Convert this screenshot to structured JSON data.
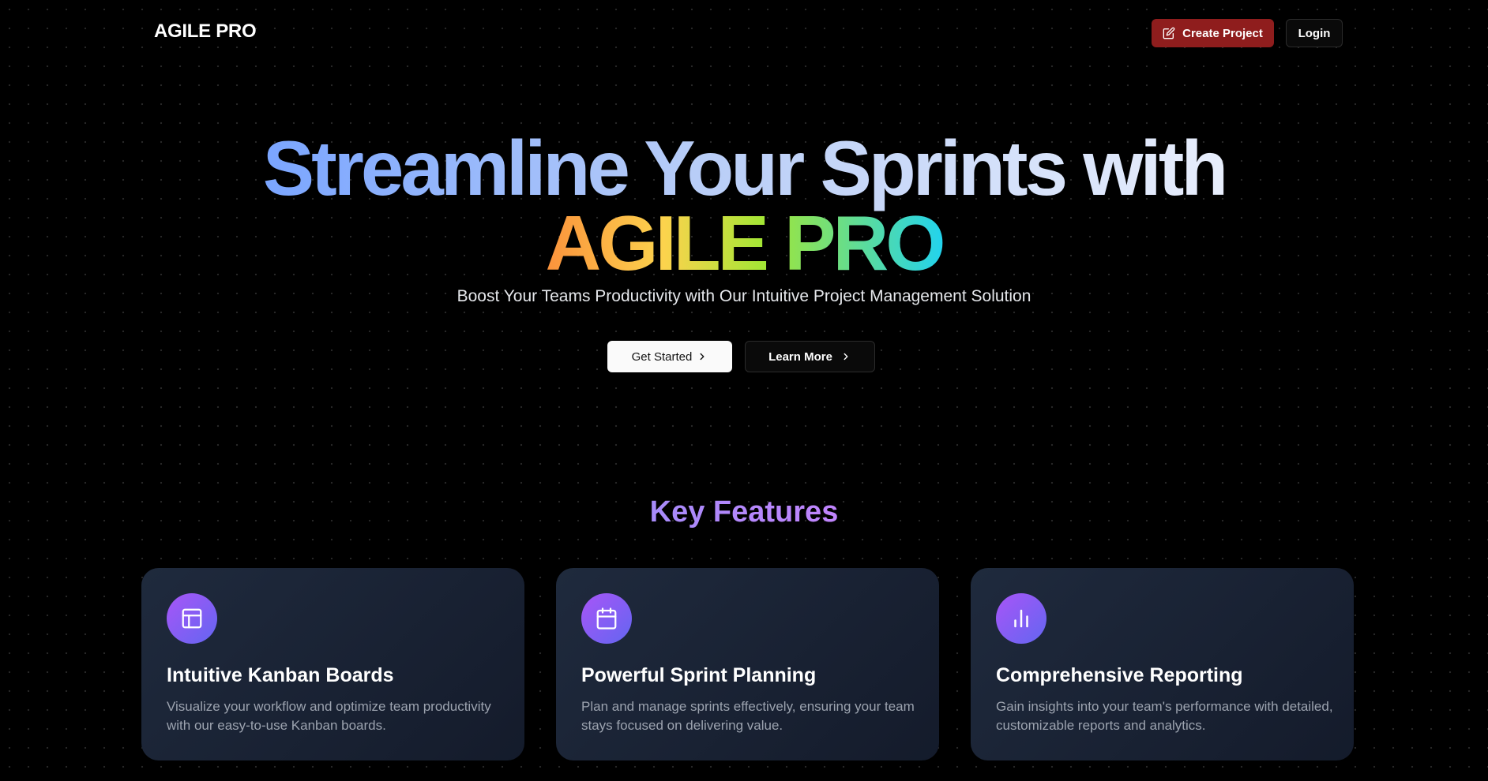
{
  "nav": {
    "logo": "AGILE PRO",
    "create_project_label": "Create Project",
    "login_label": "Login",
    "create_color": "#8f1d1d"
  },
  "hero": {
    "line1": "Streamline Your Sprints with",
    "line2": "AGILE PRO",
    "subtitle": "Boost Your Teams Productivity with Our Intuitive Project Management Solution",
    "get_started_label": "Get Started",
    "learn_more_label": "Learn More"
  },
  "features": {
    "title": "Key Features",
    "cards": [
      {
        "icon": "layout-icon",
        "title": "Intuitive Kanban Boards",
        "description": "Visualize your workflow and optimize team productivity with our easy-to-use Kanban boards."
      },
      {
        "icon": "calendar-icon",
        "title": "Powerful Sprint Planning",
        "description": "Plan and manage sprints effectively, ensuring your team stays focused on delivering value."
      },
      {
        "icon": "bar-chart-icon",
        "title": "Comprehensive Reporting",
        "description": "Gain insights into your team's performance with detailed, customizable reports and analytics."
      }
    ]
  }
}
